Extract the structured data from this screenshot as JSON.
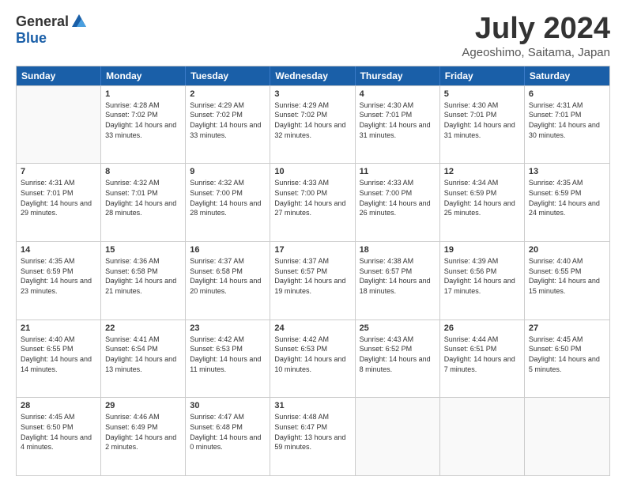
{
  "logo": {
    "general": "General",
    "blue": "Blue"
  },
  "title": "July 2024",
  "subtitle": "Ageoshimo, Saitama, Japan",
  "headers": [
    "Sunday",
    "Monday",
    "Tuesday",
    "Wednesday",
    "Thursday",
    "Friday",
    "Saturday"
  ],
  "rows": [
    [
      {
        "day": "",
        "empty": true
      },
      {
        "day": "1",
        "rise": "4:28 AM",
        "set": "7:02 PM",
        "daylight": "14 hours and 33 minutes."
      },
      {
        "day": "2",
        "rise": "4:29 AM",
        "set": "7:02 PM",
        "daylight": "14 hours and 33 minutes."
      },
      {
        "day": "3",
        "rise": "4:29 AM",
        "set": "7:02 PM",
        "daylight": "14 hours and 32 minutes."
      },
      {
        "day": "4",
        "rise": "4:30 AM",
        "set": "7:01 PM",
        "daylight": "14 hours and 31 minutes."
      },
      {
        "day": "5",
        "rise": "4:30 AM",
        "set": "7:01 PM",
        "daylight": "14 hours and 31 minutes."
      },
      {
        "day": "6",
        "rise": "4:31 AM",
        "set": "7:01 PM",
        "daylight": "14 hours and 30 minutes."
      }
    ],
    [
      {
        "day": "7",
        "rise": "4:31 AM",
        "set": "7:01 PM",
        "daylight": "14 hours and 29 minutes."
      },
      {
        "day": "8",
        "rise": "4:32 AM",
        "set": "7:01 PM",
        "daylight": "14 hours and 28 minutes."
      },
      {
        "day": "9",
        "rise": "4:32 AM",
        "set": "7:00 PM",
        "daylight": "14 hours and 28 minutes."
      },
      {
        "day": "10",
        "rise": "4:33 AM",
        "set": "7:00 PM",
        "daylight": "14 hours and 27 minutes."
      },
      {
        "day": "11",
        "rise": "4:33 AM",
        "set": "7:00 PM",
        "daylight": "14 hours and 26 minutes."
      },
      {
        "day": "12",
        "rise": "4:34 AM",
        "set": "6:59 PM",
        "daylight": "14 hours and 25 minutes."
      },
      {
        "day": "13",
        "rise": "4:35 AM",
        "set": "6:59 PM",
        "daylight": "14 hours and 24 minutes."
      }
    ],
    [
      {
        "day": "14",
        "rise": "4:35 AM",
        "set": "6:59 PM",
        "daylight": "14 hours and 23 minutes."
      },
      {
        "day": "15",
        "rise": "4:36 AM",
        "set": "6:58 PM",
        "daylight": "14 hours and 21 minutes."
      },
      {
        "day": "16",
        "rise": "4:37 AM",
        "set": "6:58 PM",
        "daylight": "14 hours and 20 minutes."
      },
      {
        "day": "17",
        "rise": "4:37 AM",
        "set": "6:57 PM",
        "daylight": "14 hours and 19 minutes."
      },
      {
        "day": "18",
        "rise": "4:38 AM",
        "set": "6:57 PM",
        "daylight": "14 hours and 18 minutes."
      },
      {
        "day": "19",
        "rise": "4:39 AM",
        "set": "6:56 PM",
        "daylight": "14 hours and 17 minutes."
      },
      {
        "day": "20",
        "rise": "4:40 AM",
        "set": "6:55 PM",
        "daylight": "14 hours and 15 minutes."
      }
    ],
    [
      {
        "day": "21",
        "rise": "4:40 AM",
        "set": "6:55 PM",
        "daylight": "14 hours and 14 minutes."
      },
      {
        "day": "22",
        "rise": "4:41 AM",
        "set": "6:54 PM",
        "daylight": "14 hours and 13 minutes."
      },
      {
        "day": "23",
        "rise": "4:42 AM",
        "set": "6:53 PM",
        "daylight": "14 hours and 11 minutes."
      },
      {
        "day": "24",
        "rise": "4:42 AM",
        "set": "6:53 PM",
        "daylight": "14 hours and 10 minutes."
      },
      {
        "day": "25",
        "rise": "4:43 AM",
        "set": "6:52 PM",
        "daylight": "14 hours and 8 minutes."
      },
      {
        "day": "26",
        "rise": "4:44 AM",
        "set": "6:51 PM",
        "daylight": "14 hours and 7 minutes."
      },
      {
        "day": "27",
        "rise": "4:45 AM",
        "set": "6:50 PM",
        "daylight": "14 hours and 5 minutes."
      }
    ],
    [
      {
        "day": "28",
        "rise": "4:45 AM",
        "set": "6:50 PM",
        "daylight": "14 hours and 4 minutes."
      },
      {
        "day": "29",
        "rise": "4:46 AM",
        "set": "6:49 PM",
        "daylight": "14 hours and 2 minutes."
      },
      {
        "day": "30",
        "rise": "4:47 AM",
        "set": "6:48 PM",
        "daylight": "14 hours and 0 minutes."
      },
      {
        "day": "31",
        "rise": "4:48 AM",
        "set": "6:47 PM",
        "daylight": "13 hours and 59 minutes."
      },
      {
        "day": "",
        "empty": true
      },
      {
        "day": "",
        "empty": true
      },
      {
        "day": "",
        "empty": true
      }
    ]
  ],
  "labels": {
    "sunrise": "Sunrise:",
    "sunset": "Sunset:",
    "daylight": "Daylight:"
  }
}
